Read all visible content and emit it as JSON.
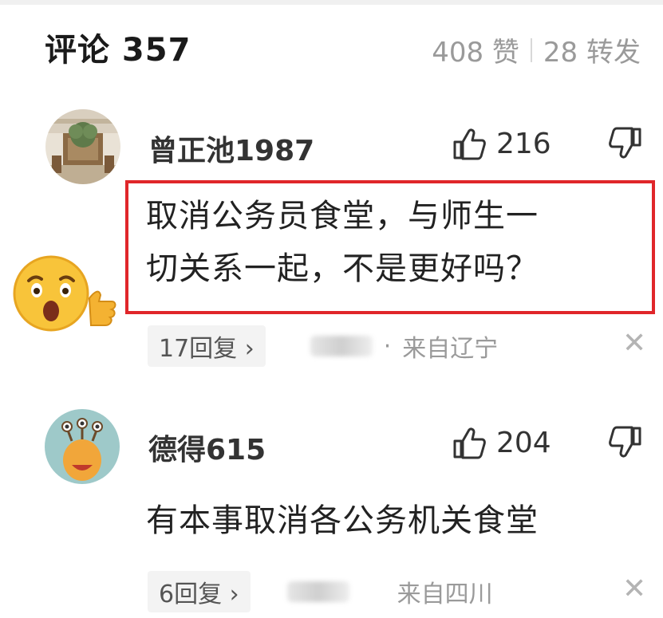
{
  "header": {
    "title": "评论 357",
    "likes": "408 赞",
    "reposts": "28 转发"
  },
  "comments": [
    {
      "username": "曾正池1987",
      "likes": "216",
      "text_line1": "取消公务员食堂，与师生一",
      "text_line2": "切关系一起，不是更好吗？",
      "replies": "17回复",
      "reply_arrow": "›",
      "location": "来自辽宁",
      "dot": "·",
      "close": "✕"
    },
    {
      "username": "德得615",
      "likes": "204",
      "text": "有本事取消各公务机关食堂",
      "replies": "6回复",
      "reply_arrow": "›",
      "location": "来自四川",
      "close": "✕"
    }
  ],
  "icons": {
    "thumb_up": "thumbs-up-icon",
    "thumb_down": "thumbs-down-icon",
    "emoji": "surprised-thumbs-up-emoji",
    "close": "close-icon"
  },
  "colors": {
    "highlight_border": "#e0262a",
    "muted_text": "#9a9a9a"
  }
}
